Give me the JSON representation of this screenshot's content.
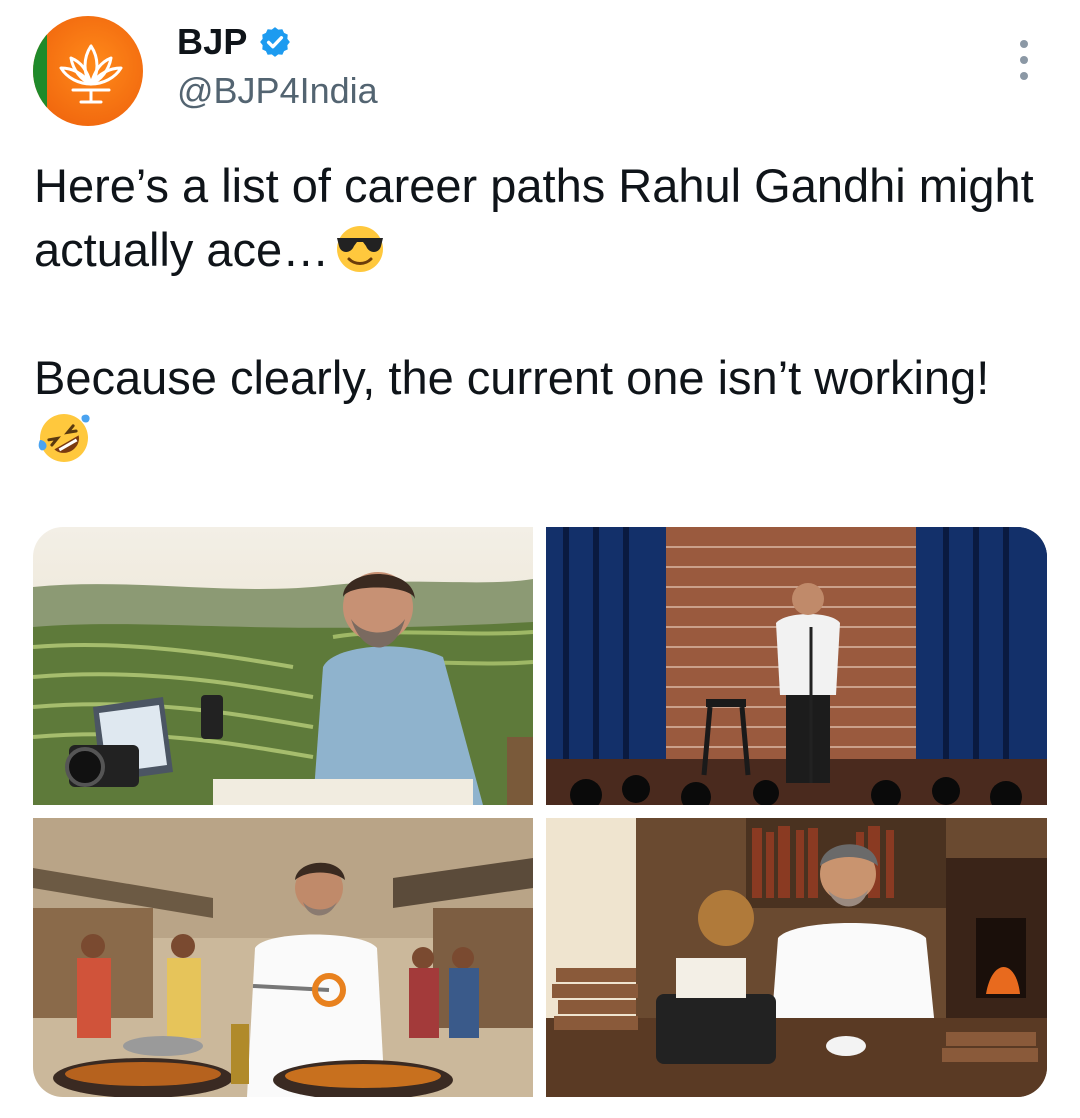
{
  "author": {
    "display_name": "BJP",
    "handle": "@BJP4India",
    "verified": true,
    "avatar_icon": "lotus-icon",
    "colors": {
      "avatar_saffron": "#f26a0f",
      "avatar_green": "#1f8a2a",
      "verified_blue": "#1d9bf0"
    }
  },
  "tweet": {
    "line1": "Here’s a list of career paths Rahul Gandhi might actually ace…",
    "line2": "Because clearly, the current one isn’t working!",
    "emoji1": "smiling-face-with-sunglasses-icon",
    "emoji2": "rolling-on-the-floor-laughing-icon"
  },
  "media": [
    {
      "scene": "terraced-fields-vlogger"
    },
    {
      "scene": "standup-comedy-stage"
    },
    {
      "scene": "street-food-jalebi"
    },
    {
      "scene": "typewriter-writer-study"
    }
  ]
}
